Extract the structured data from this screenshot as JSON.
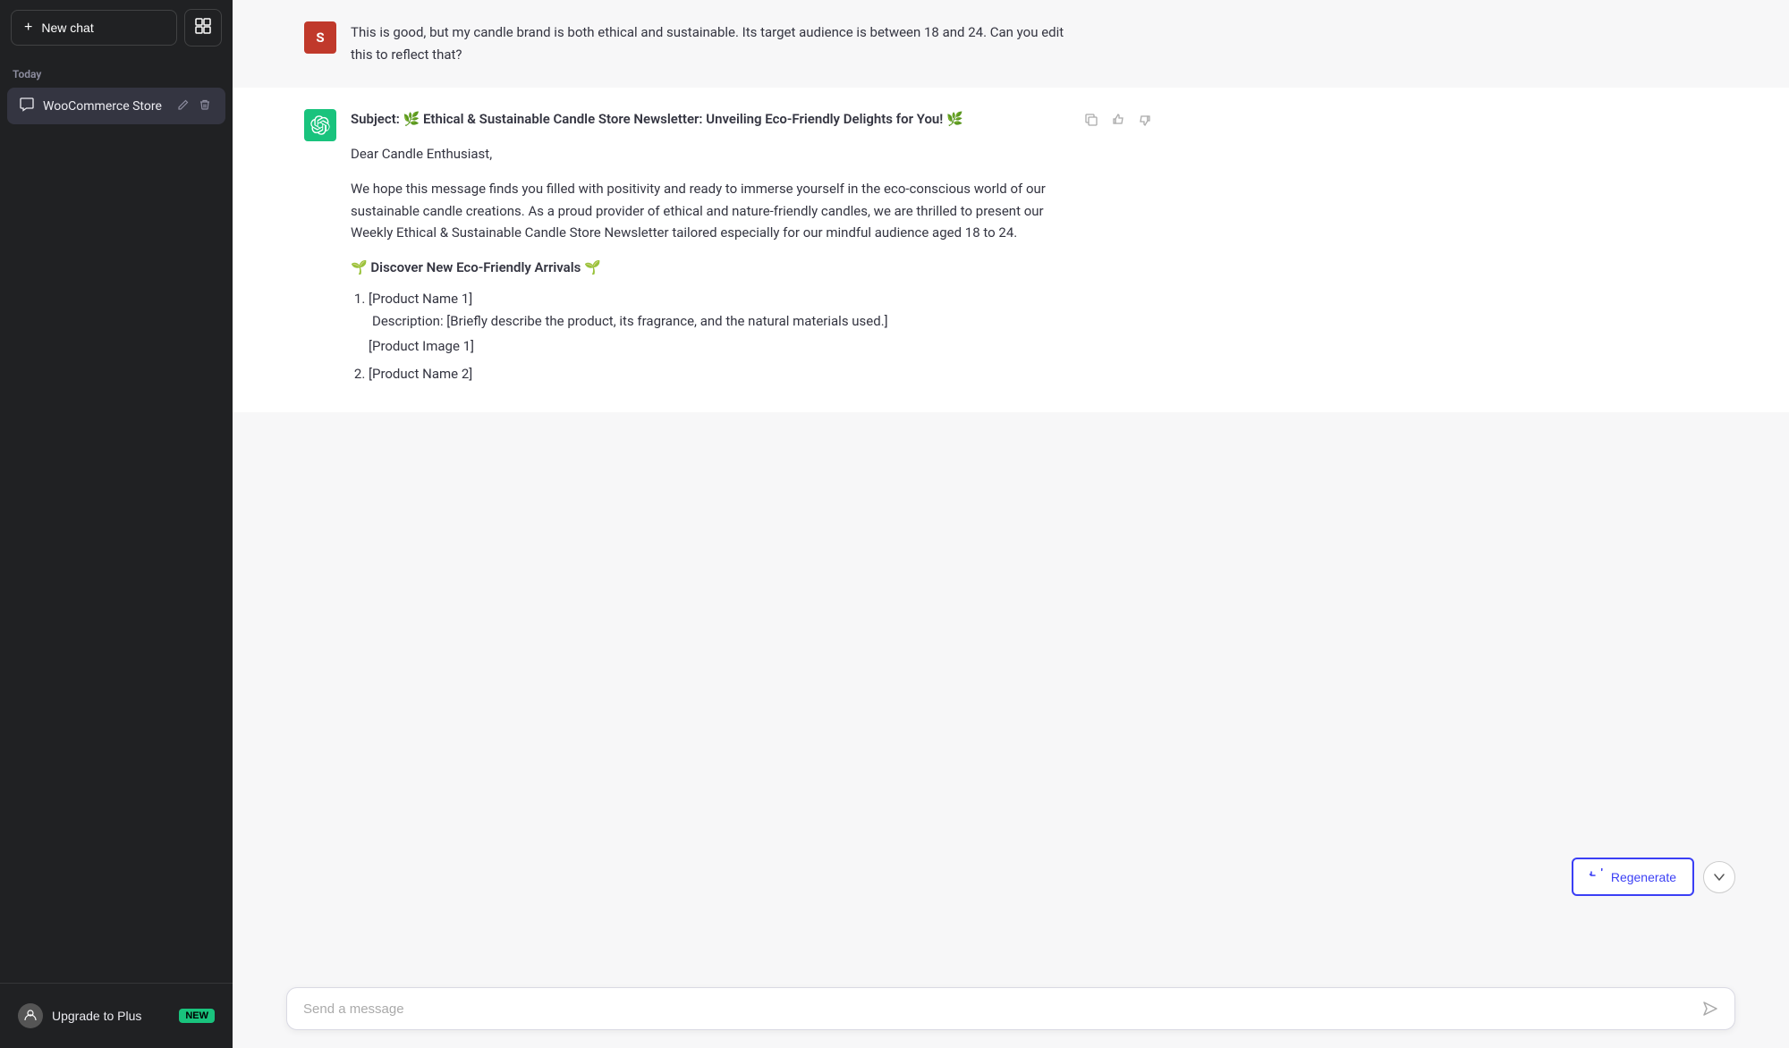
{
  "sidebar": {
    "new_chat_label": "New chat",
    "today_label": "Today",
    "chat_item_label": "WooCommerce Store",
    "upgrade_label": "Upgrade to Plus",
    "upgrade_badge": "NEW",
    "layout_icon_unicode": "⊞"
  },
  "messages": [
    {
      "role": "user",
      "avatar_letter": "S",
      "text": "This is good, but my candle brand is both ethical and sustainable. Its target audience is between 18 and 24. Can you edit this to reflect that?"
    },
    {
      "role": "assistant",
      "subject_line": "Subject: 🌿 Ethical & Sustainable Candle Store Newsletter: Unveiling Eco-Friendly Delights for You! 🌿",
      "greeting": "Dear Candle Enthusiast,",
      "body_para": "We hope this message finds you filled with positivity and ready to immerse yourself in the eco-conscious world of our sustainable candle creations. As a proud provider of ethical and nature-friendly candles, we are thrilled to present our Weekly Ethical & Sustainable Candle Store Newsletter tailored especially for our mindful audience aged 18 to 24.",
      "section_heading": "🌱 Discover New Eco-Friendly Arrivals 🌱",
      "product1_name": "[Product Name 1]",
      "product1_desc": "Description: [Briefly describe the product, its fragrance, and the natural materials used.]",
      "product1_image": "[Product Image 1]",
      "product2_name": "[Product Name 2]"
    }
  ],
  "input": {
    "placeholder": "Send a message"
  },
  "regenerate_label": "Regenerate",
  "send_icon_unicode": "➤"
}
